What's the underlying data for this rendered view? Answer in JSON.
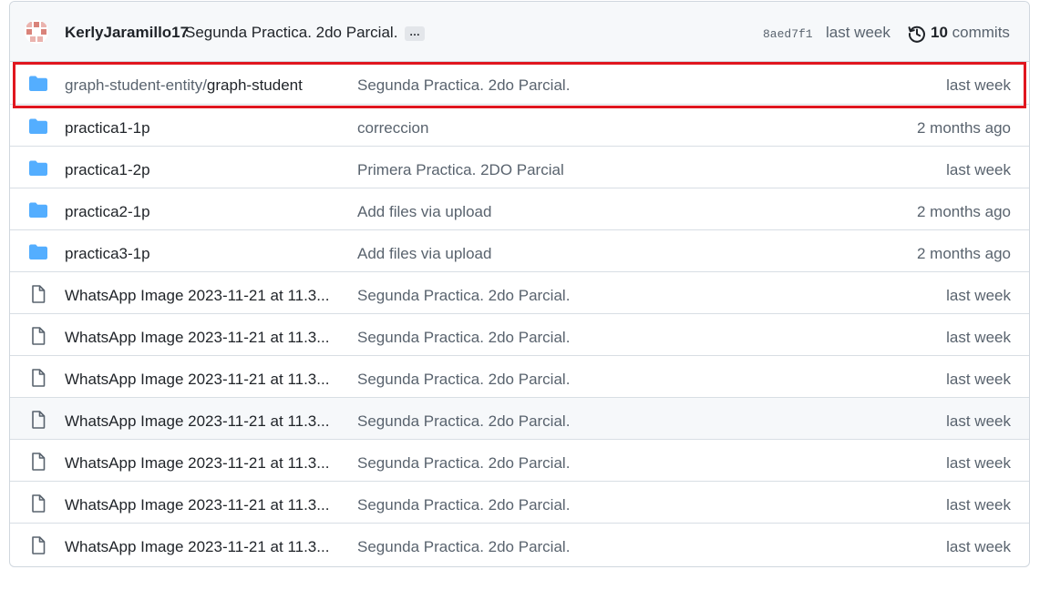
{
  "latest_commit": {
    "author": "KerlyJaramillo17",
    "message": "Segunda Practica. 2do Parcial.",
    "expand_label": "…",
    "sha": "8aed7f1",
    "time": "last week",
    "commit_count": "10",
    "commits_label": "commits"
  },
  "files": [
    {
      "type": "folder",
      "name_prefix": "graph-student-entity/",
      "name": "graph-student",
      "message": "Segunda Practica. 2do Parcial.",
      "age": "last week"
    },
    {
      "type": "folder",
      "name_prefix": "",
      "name": "practica1-1p",
      "message": "correccion",
      "age": "2 months ago"
    },
    {
      "type": "folder",
      "name_prefix": "",
      "name": "practica1-2p",
      "message": "Primera Practica. 2DO Parcial",
      "age": "last week"
    },
    {
      "type": "folder",
      "name_prefix": "",
      "name": "practica2-1p",
      "message": "Add files via upload",
      "age": "2 months ago"
    },
    {
      "type": "folder",
      "name_prefix": "",
      "name": "practica3-1p",
      "message": "Add files via upload",
      "age": "2 months ago"
    },
    {
      "type": "file",
      "name_prefix": "",
      "name": "WhatsApp Image 2023-11-21 at 11.3...",
      "message": "Segunda Practica. 2do Parcial.",
      "age": "last week"
    },
    {
      "type": "file",
      "name_prefix": "",
      "name": "WhatsApp Image 2023-11-21 at 11.3...",
      "message": "Segunda Practica. 2do Parcial.",
      "age": "last week"
    },
    {
      "type": "file",
      "name_prefix": "",
      "name": "WhatsApp Image 2023-11-21 at 11.3...",
      "message": "Segunda Practica. 2do Parcial.",
      "age": "last week"
    },
    {
      "type": "file",
      "name_prefix": "",
      "name": "WhatsApp Image 2023-11-21 at 11.3...",
      "message": "Segunda Practica. 2do Parcial.",
      "age": "last week"
    },
    {
      "type": "file",
      "name_prefix": "",
      "name": "WhatsApp Image 2023-11-21 at 11.3...",
      "message": "Segunda Practica. 2do Parcial.",
      "age": "last week"
    },
    {
      "type": "file",
      "name_prefix": "",
      "name": "WhatsApp Image 2023-11-21 at 11.3...",
      "message": "Segunda Practica. 2do Parcial.",
      "age": "last week"
    },
    {
      "type": "file",
      "name_prefix": "",
      "name": "WhatsApp Image 2023-11-21 at 11.3...",
      "message": "Segunda Practica. 2do Parcial.",
      "age": "last week"
    }
  ],
  "colors": {
    "folder": "#54aeff",
    "highlight": "#e0161f",
    "muted_text": "#59636e"
  },
  "icons": {
    "folder": "folder-icon",
    "file": "file-icon",
    "history": "history-icon",
    "avatar": "avatar"
  }
}
